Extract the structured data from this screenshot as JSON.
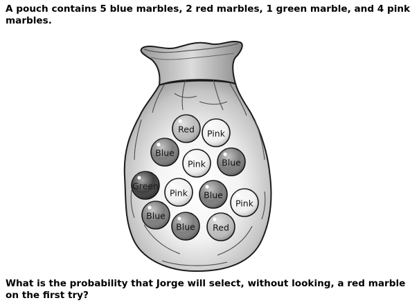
{
  "question": {
    "intro": "A pouch contains 5 blue marbles, 2 red marbles, 1 green marble, and 4 pink marbles.",
    "prompt": "What is the probability that Jorge will select, without looking, a red marble on the first try?"
  },
  "marbles": [
    {
      "label": "Red",
      "color": "red"
    },
    {
      "label": "Pink",
      "color": "pink"
    },
    {
      "label": "Blue",
      "color": "blue"
    },
    {
      "label": "Pink",
      "color": "pink"
    },
    {
      "label": "Blue",
      "color": "blue"
    },
    {
      "label": "Green",
      "color": "green"
    },
    {
      "label": "Pink",
      "color": "pink"
    },
    {
      "label": "Blue",
      "color": "blue"
    },
    {
      "label": "Pink",
      "color": "pink"
    },
    {
      "label": "Blue",
      "color": "blue"
    },
    {
      "label": "Blue",
      "color": "blue"
    },
    {
      "label": "Red",
      "color": "red"
    }
  ],
  "colors": {
    "blue": "#7d7d7d",
    "red": "#bdbdbd",
    "pink": "#f2f2f2",
    "green": "#3f3f3f",
    "pouch": "#cfcfcf",
    "pouch_shadow": "#9a9a9a",
    "pouch_glow": "#ffffff"
  }
}
